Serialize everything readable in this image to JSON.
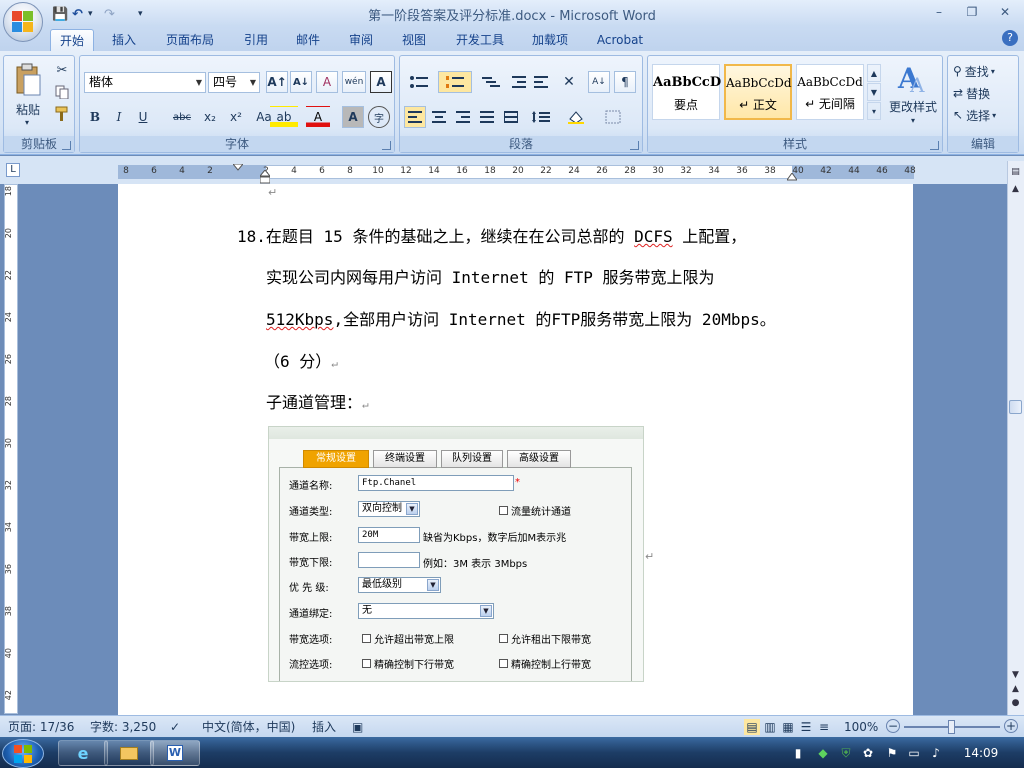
{
  "window": {
    "title": "第一阶段答案及评分标准.docx - Microsoft Word",
    "minimize": "–",
    "restore": "❐",
    "close": "✕"
  },
  "quick_access": {
    "save": "💾",
    "undo": "↶",
    "undo_drop": "▾",
    "redo": "↷",
    "customize": "▾"
  },
  "tabs": [
    "开始",
    "插入",
    "页面布局",
    "引用",
    "邮件",
    "审阅",
    "视图",
    "开发工具",
    "加载项",
    "Acrobat"
  ],
  "active_tab": "开始",
  "ribbon": {
    "clipboard": {
      "label": "剪贴板",
      "paste": "粘贴",
      "paste_drop": "▾"
    },
    "font": {
      "label": "字体",
      "font_name": "楷体",
      "font_size": "四号",
      "grow": "A↑",
      "shrink": "A↓",
      "clear_format": "A",
      "phonetic": "wén",
      "char_border": "A",
      "bold": "B",
      "italic": "I",
      "underline": "U",
      "strike": "abc",
      "subscript": "x₂",
      "superscript": "x²",
      "change_case": "Aa",
      "highlight": "ab",
      "font_color": "A",
      "char_shading": "A",
      "enclose": "字"
    },
    "paragraph": {
      "label": "段落"
    },
    "styles": {
      "label": "样式",
      "items": [
        {
          "sample": "AaBbCcD",
          "name": "要点"
        },
        {
          "sample": "AaBbCcDd",
          "name": "↵ 正文"
        },
        {
          "sample": "AaBbCcDd",
          "name": "↵ 无间隔"
        }
      ],
      "change_styles": "更改样式",
      "change_styles_drop": "▾"
    },
    "editing": {
      "label": "编辑",
      "find": "查找",
      "replace": "替换",
      "select": "选择"
    }
  },
  "ruler": {
    "corner": "L",
    "h_ticks": [
      "8",
      "6",
      "4",
      "2",
      "",
      "2",
      "4",
      "6",
      "8",
      "10",
      "12",
      "14",
      "16",
      "18",
      "20",
      "22",
      "24",
      "26",
      "28",
      "30",
      "32",
      "34",
      "36",
      "38",
      "40",
      "42",
      "44",
      "46",
      "48"
    ],
    "v_ticks": [
      "18",
      "20",
      "22",
      "24",
      "26",
      "28",
      "30",
      "32",
      "34",
      "36",
      "38",
      "40",
      "42"
    ]
  },
  "document": {
    "paragraph_mark": "↵",
    "q_number": "18.",
    "line1_a": "在题目 15 条件的基础之上，继续在在公司总部的",
    "line1_b": "DCFS",
    "line1_c": "上配置，",
    "line2": "实现公司内网每用户访问 Internet 的 FTP 服务带宽上限为",
    "line3_a": "512Kbps",
    "line3_b": ",全部用户访问 Internet 的FTP服务带宽上限为 20Mbps。",
    "line4": "（6 分）",
    "line5": "子通道管理：",
    "screenshot": {
      "tabs": [
        "常规设置",
        "终端设置",
        "队列设置",
        "高级设置"
      ],
      "active_tab": "常规设置",
      "channel_name_label": "通道名称:",
      "channel_name_value": "Ftp.Chanel",
      "required_mark": "*",
      "channel_type_label": "通道类型:",
      "channel_type_value": "双向控制",
      "traffic_stats_label": "流量统计通道",
      "bw_upper_label": "带宽上限:",
      "bw_upper_value": "20M",
      "bw_upper_hint": "缺省为Kbps，数字后加M表示兆",
      "bw_lower_label": "带宽下限:",
      "bw_lower_value": "",
      "bw_lower_hint": "例如：3M 表示  3Mbps",
      "priority_label": "优 先 级:",
      "priority_value": "最低级别",
      "binding_label": "通道绑定:",
      "binding_value": "无",
      "bw_options_label": "带宽选项:",
      "bw_opt1": "允许超出带宽上限",
      "bw_opt2": "允许租出下限带宽",
      "flow_label": "流控选项:",
      "flow_opt1": "精确控制下行带宽",
      "flow_opt2": "精确控制上行带宽"
    }
  },
  "status_bar": {
    "page": "页面: 17/36",
    "words": "字数: 3,250",
    "language": "中文(简体，中国)",
    "insert_mode": "插入",
    "zoom": "100%",
    "zoom_minus": "−",
    "zoom_plus": "+"
  },
  "taskbar": {
    "clock": "14:09"
  }
}
